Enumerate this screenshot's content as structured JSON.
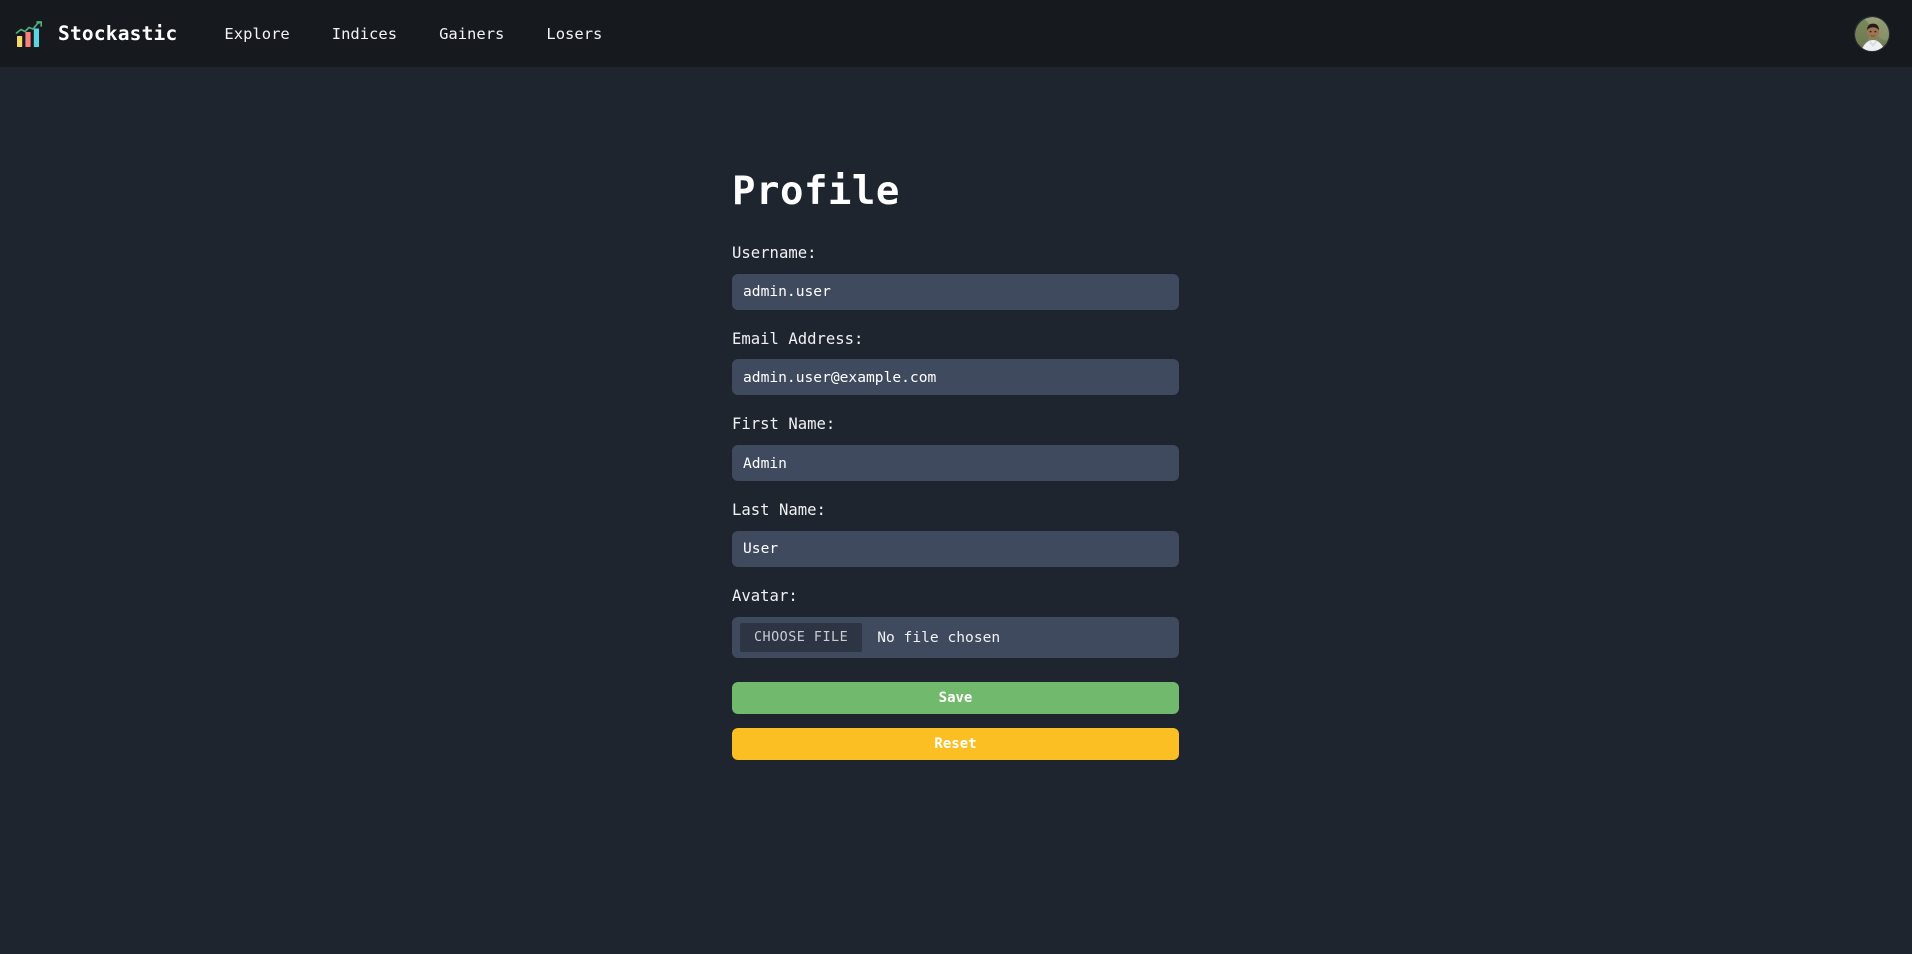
{
  "navbar": {
    "brand": {
      "name": "Stockastic",
      "logo_icon": "bar-chart-trend-icon",
      "logo_colors": {
        "bar1": "#f5d76e",
        "bar2": "#fc7f7f",
        "bar3": "#5bd6e0",
        "trendline": "#4caf7d"
      }
    },
    "links": [
      {
        "label": "Explore"
      },
      {
        "label": "Indices"
      },
      {
        "label": "Gainers"
      },
      {
        "label": "Losers"
      }
    ],
    "avatar": {
      "icon": "user-avatar-icon",
      "alt": "User profile photo"
    }
  },
  "main": {
    "title": "Profile",
    "fields": [
      {
        "label": "Username:",
        "value": "admin.user",
        "placeholder": "",
        "name": "username"
      },
      {
        "label": "Email Address:",
        "value": "admin.user@example.com",
        "placeholder": "",
        "name": "email"
      },
      {
        "label": "First Name:",
        "value": "Admin",
        "placeholder": "",
        "name": "first-name"
      },
      {
        "label": "Last Name:",
        "value": "User",
        "placeholder": "",
        "name": "last-name"
      }
    ],
    "avatar_field": {
      "label": "Avatar:",
      "choose_button": "CHOOSE FILE",
      "status": "No file chosen"
    },
    "buttons": {
      "save": "Save",
      "reset": "Reset"
    }
  },
  "colors": {
    "page_bg": "#1f252e",
    "navbar_bg": "#16191e",
    "input_bg": "#3f4a5e",
    "save_green": "#71b96d",
    "reset_yellow": "#fbbf24",
    "choose_file_bg": "#2d3544",
    "text_primary": "#ffffff"
  }
}
